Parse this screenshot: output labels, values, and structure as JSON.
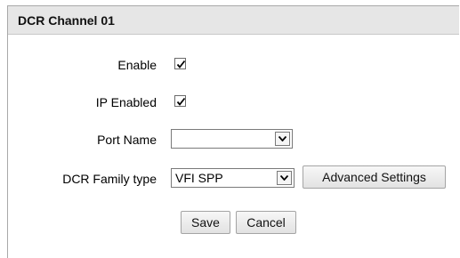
{
  "panel": {
    "title": "DCR Channel 01"
  },
  "form": {
    "enable": {
      "label": "Enable",
      "checked": true
    },
    "ip_enabled": {
      "label": "IP Enabled",
      "checked": true
    },
    "port_name": {
      "label": "Port Name",
      "value": ""
    },
    "family_type": {
      "label": "DCR Family type",
      "value": "VFI SPP"
    }
  },
  "buttons": {
    "advanced": "Advanced Settings",
    "save": "Save",
    "cancel": "Cancel"
  },
  "icons": {
    "checkmark": "checkmark-icon",
    "dropdown": "chevron-down-icon"
  }
}
